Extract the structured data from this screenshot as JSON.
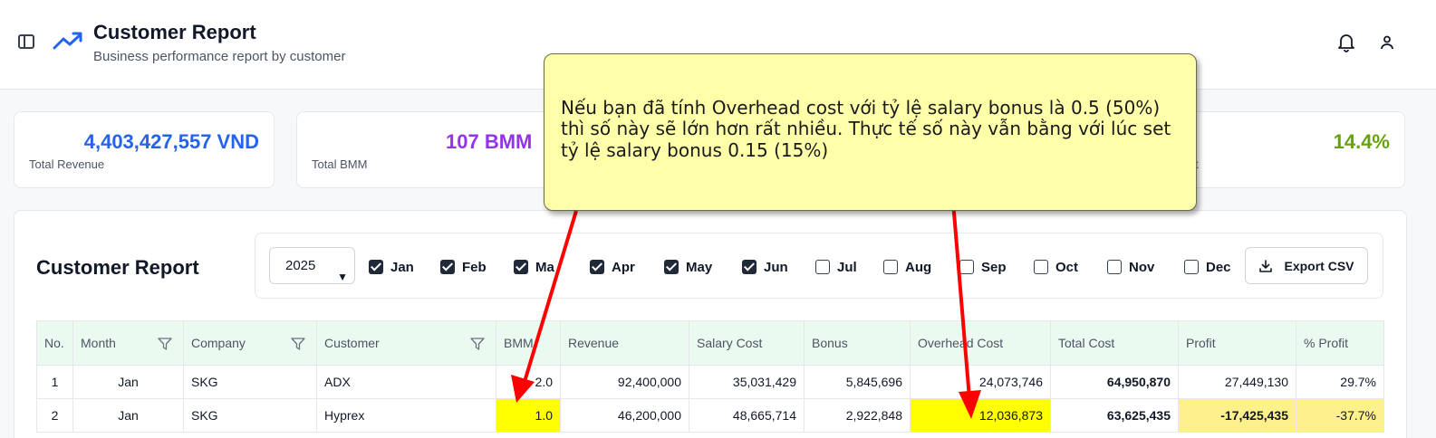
{
  "header": {
    "title": "Customer Report",
    "subtitle": "Business performance report by customer"
  },
  "cards": [
    {
      "value": "4,403,427,557 VND",
      "label": "Total Revenue",
      "color": "#2563eb"
    },
    {
      "value": "107 BMM",
      "label": "Total BMM",
      "color": "#9333ea"
    },
    {
      "value": "14.4%",
      "label": "t",
      "color": "#65a30d"
    }
  ],
  "report": {
    "title": "Customer Report",
    "year": "2025",
    "export_label": "Export CSV",
    "months": [
      {
        "label": "Jan",
        "checked": true
      },
      {
        "label": "Feb",
        "checked": true
      },
      {
        "label": "Ma",
        "checked": true
      },
      {
        "label": "Apr",
        "checked": true
      },
      {
        "label": "May",
        "checked": true
      },
      {
        "label": "Jun",
        "checked": true
      },
      {
        "label": "Jul",
        "checked": false
      },
      {
        "label": "Aug",
        "checked": false
      },
      {
        "label": "Sep",
        "checked": false
      },
      {
        "label": "Oct",
        "checked": false
      },
      {
        "label": "Nov",
        "checked": false
      },
      {
        "label": "Dec",
        "checked": false
      }
    ]
  },
  "table": {
    "columns": [
      "No.",
      "Month",
      "Company",
      "Customer",
      "BMM",
      "Revenue",
      "Salary Cost",
      "Bonus",
      "Overhead Cost",
      "Total Cost",
      "Profit",
      "% Profit"
    ],
    "rows": [
      [
        "1",
        "Jan",
        "SKG",
        "ADX",
        "2.0",
        "92,400,000",
        "35,031,429",
        "5,845,696",
        "24,073,746",
        "64,950,870",
        "27,449,130",
        "29.7%"
      ],
      [
        "2",
        "Jan",
        "SKG",
        "Hyprex",
        "1.0",
        "46,200,000",
        "48,665,714",
        "2,922,848",
        "12,036,873",
        "63,625,435",
        "-17,425,435",
        "-37.7%"
      ]
    ]
  },
  "callout": {
    "text": "Nếu bạn đã tính Overhead cost với tỷ lệ salary bonus là 0.5 (50%) thì số này sẽ lớn hơn rất nhiều. Thực tế số này vẫn bằng với lúc set tỷ lệ salary bonus 0.15 (15%)",
    "arrow_color": "#ff0000",
    "highlight_color": "#ffff00"
  }
}
